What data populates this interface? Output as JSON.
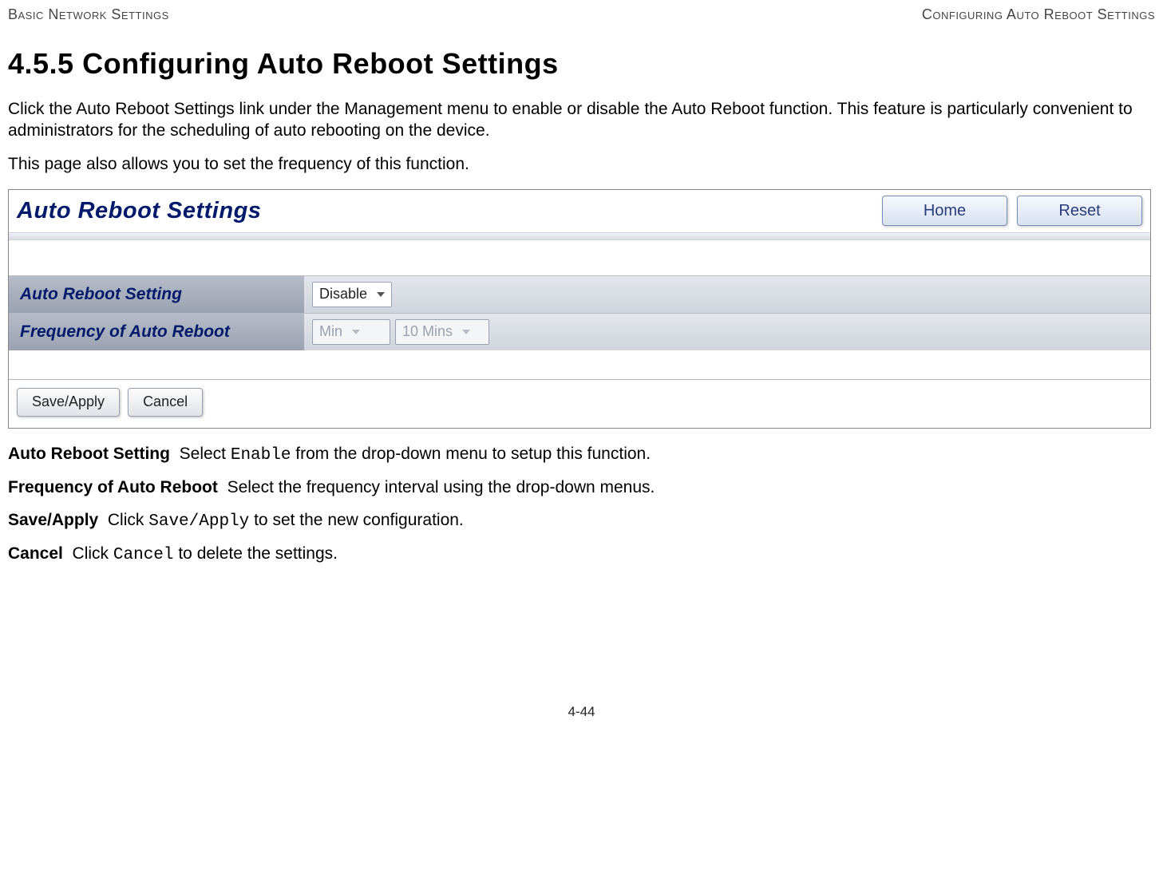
{
  "header": {
    "left": "Basic Network Settings",
    "right": "Configuring Auto Reboot Settings"
  },
  "section": {
    "number": "4.5.5",
    "title": "Configuring Auto Reboot Settings"
  },
  "paragraphs": {
    "p1": "Click the Auto Reboot Settings link under the Management menu to enable or disable the Auto Reboot function. This feature is particularly convenient to administrators for the scheduling of auto rebooting on the device.",
    "p2": "This page also allows you to set the frequency of this function."
  },
  "screenshot": {
    "title": "Auto Reboot Settings",
    "buttons": {
      "home": "Home",
      "reset": "Reset"
    },
    "rows": {
      "auto_reboot_label": "Auto Reboot Setting",
      "auto_reboot_value": "Disable",
      "frequency_label": "Frequency of Auto Reboot",
      "frequency_unit": "Min",
      "frequency_value": "10 Mins"
    },
    "footer": {
      "save_apply": "Save/Apply",
      "cancel": "Cancel"
    }
  },
  "definitions": {
    "auto_reboot": {
      "term": "Auto Reboot Setting",
      "pre": "Select ",
      "code": "Enable",
      "post": " from the drop-down menu to setup this function."
    },
    "frequency": {
      "term": "Frequency of Auto Reboot",
      "text": "Select the frequency interval using the drop-down menus."
    },
    "save_apply": {
      "term": "Save/Apply",
      "pre": "Click ",
      "code": "Save/Apply",
      "post": " to set the new configuration."
    },
    "cancel": {
      "term": "Cancel",
      "pre": "Click ",
      "code": "Cancel",
      "post": " to delete the settings."
    }
  },
  "footer": {
    "page_number": "4-44"
  }
}
